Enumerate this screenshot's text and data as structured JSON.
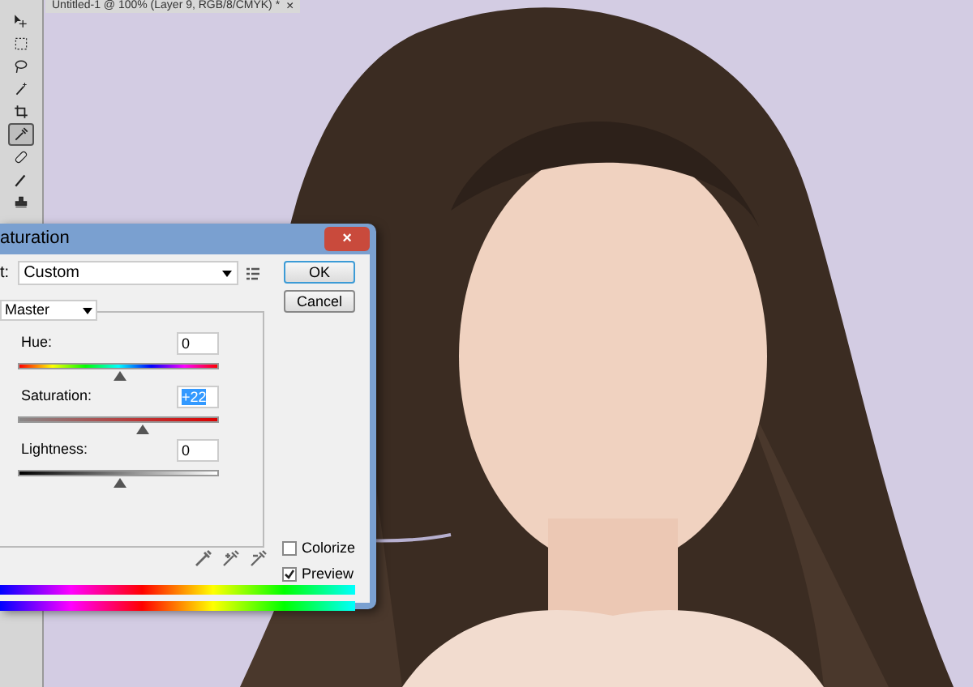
{
  "document_tab": {
    "title": "Untitled-1 @ 100% (Layer 9, RGB/8/CMYK) *",
    "close": "×"
  },
  "tools": [
    {
      "kind": "move",
      "selected": false
    },
    {
      "kind": "marquee",
      "selected": false
    },
    {
      "kind": "lasso",
      "selected": false
    },
    {
      "kind": "wand",
      "selected": false
    },
    {
      "kind": "crop",
      "selected": false
    },
    {
      "kind": "eyedropper",
      "selected": true
    },
    {
      "kind": "heal",
      "selected": false
    },
    {
      "kind": "brush",
      "selected": false
    },
    {
      "kind": "stamp",
      "selected": false
    }
  ],
  "dialog": {
    "title": "aturation",
    "close": "×",
    "preset_label": "t:",
    "preset": "Custom",
    "channel": "Master",
    "sliders": [
      {
        "label": "Hue:",
        "value": "0",
        "level": 0.5,
        "kind": "hue",
        "selected": false
      },
      {
        "label": "Saturation:",
        "value": "+22",
        "level": 0.61,
        "kind": "saturation",
        "selected": true
      },
      {
        "label": "Lightness:",
        "value": "0",
        "level": 0.5,
        "kind": "lightness",
        "selected": false
      }
    ],
    "buttons": [
      "OK",
      "Cancel"
    ],
    "checkboxes": [
      {
        "label": "Colorize",
        "checked": false
      },
      {
        "label": "Preview",
        "checked": true
      }
    ]
  }
}
